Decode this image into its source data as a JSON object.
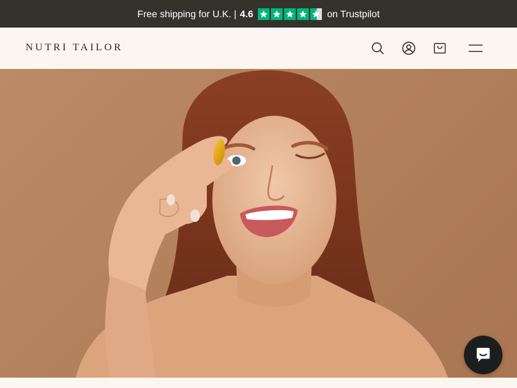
{
  "announcement": {
    "text": "Free shipping for U.K. |",
    "rating": "4.6",
    "stars": 4.5,
    "suffix": "on Trustpilot",
    "star_color": "#00b67a"
  },
  "header": {
    "logo": "NUTRI TAILOR",
    "icons": [
      "search-icon",
      "account-icon",
      "cart-icon",
      "menu-icon"
    ]
  },
  "hero": {
    "image_alt": "Woman holding a yellow supplement capsule in front of her eye, smiling and winking"
  },
  "chat": {
    "icon": "chat-icon"
  },
  "colors": {
    "bar_bg": "#33322b",
    "header_bg": "#fbf7f0",
    "hero_bg": "#b3815c",
    "chat_bg": "#1b1d1f"
  }
}
